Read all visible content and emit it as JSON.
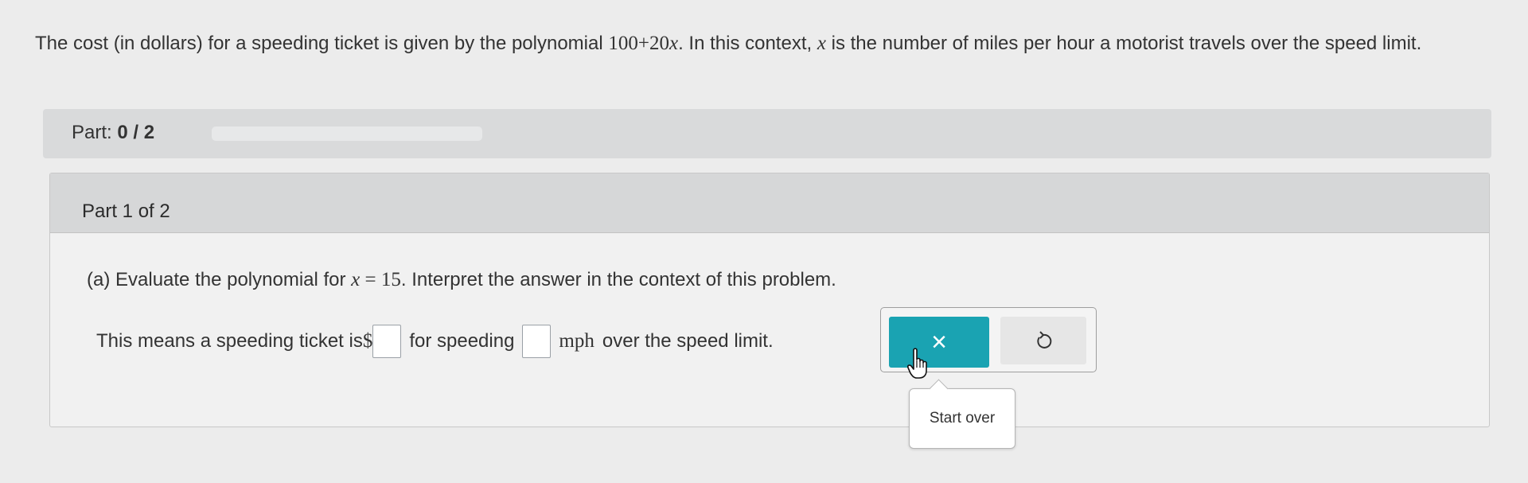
{
  "problem": {
    "text_before": "The cost (in dollars) for a speeding ticket is given by the polynomial ",
    "poly_const": "100",
    "poly_plus": "+",
    "poly_coef": "20",
    "poly_var": "x",
    "text_mid": ". In this context, ",
    "var": "x",
    "text_after": " is the number of miles per hour a motorist travels over the speed limit."
  },
  "progress": {
    "label": "Part:",
    "value": "0 / 2",
    "fraction": 0
  },
  "part": {
    "header": "Part 1 of 2",
    "question_prefix": "(a) Evaluate the polynomial for ",
    "question_var": "x",
    "question_eq": " = ",
    "question_val": "15",
    "question_suffix": ". Interpret the answer in the context of this problem.",
    "answer_prefix": "This means a speeding ticket is ",
    "dollar": "$",
    "answer_mid": "for speeding",
    "unit": "mph",
    "answer_suffix": "over the speed limit.",
    "ticket_cost_value": "",
    "mph_value": ""
  },
  "buttons": {
    "check_icon": "×",
    "reset_icon": "undo-icon"
  },
  "tooltip": {
    "text": "Start over"
  },
  "colors": {
    "accent": "#1aa3b2"
  }
}
